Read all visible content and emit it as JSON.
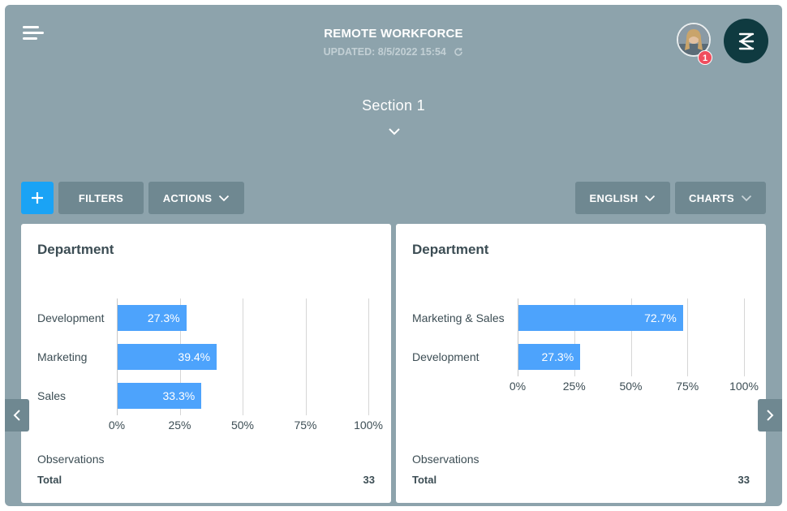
{
  "header": {
    "title": "REMOTE WORKFORCE",
    "updated": "UPDATED: 8/5/2022 15:54",
    "notification_count": "1"
  },
  "section": {
    "title": "Section 1"
  },
  "toolbar": {
    "filters_label": "FILTERS",
    "actions_label": "ACTIONS",
    "language_label": "ENGLISH",
    "charts_label": "CHARTS"
  },
  "icons": {
    "menu": "menu-icon",
    "refresh": "refresh-icon",
    "add": "plus-icon",
    "chevron": "chevron-down-icon",
    "prev": "chevron-left-icon",
    "next": "chevron-right-icon",
    "logo": "brand-logo-icon"
  },
  "colors": {
    "background": "#8da3ac",
    "button": "#6f8891",
    "accent": "#1aa3f5",
    "bar": "#4da3fc",
    "badge": "#f04e5e",
    "logo_bg": "#0f3a40"
  },
  "cards": [
    {
      "title": "Department",
      "observations_label": "Observations",
      "total_label": "Total",
      "total_value": "33"
    },
    {
      "title": "Department",
      "observations_label": "Observations",
      "total_label": "Total",
      "total_value": "33"
    }
  ],
  "chart_data": [
    {
      "type": "bar",
      "orientation": "horizontal",
      "title": "Department",
      "categories": [
        "Development",
        "Marketing",
        "Sales"
      ],
      "values": [
        27.3,
        39.4,
        33.3
      ],
      "value_labels": [
        "27.3%",
        "39.4%",
        "33.3%"
      ],
      "xticks": [
        "0%",
        "25%",
        "50%",
        "75%",
        "100%"
      ],
      "xlim": [
        0,
        100
      ],
      "grid": true
    },
    {
      "type": "bar",
      "orientation": "horizontal",
      "title": "Department",
      "categories": [
        "Marketing & Sales",
        "Development"
      ],
      "values": [
        72.7,
        27.3
      ],
      "value_labels": [
        "72.7%",
        "27.3%"
      ],
      "xticks": [
        "0%",
        "25%",
        "50%",
        "75%",
        "100%"
      ],
      "xlim": [
        0,
        100
      ],
      "grid": true
    }
  ]
}
